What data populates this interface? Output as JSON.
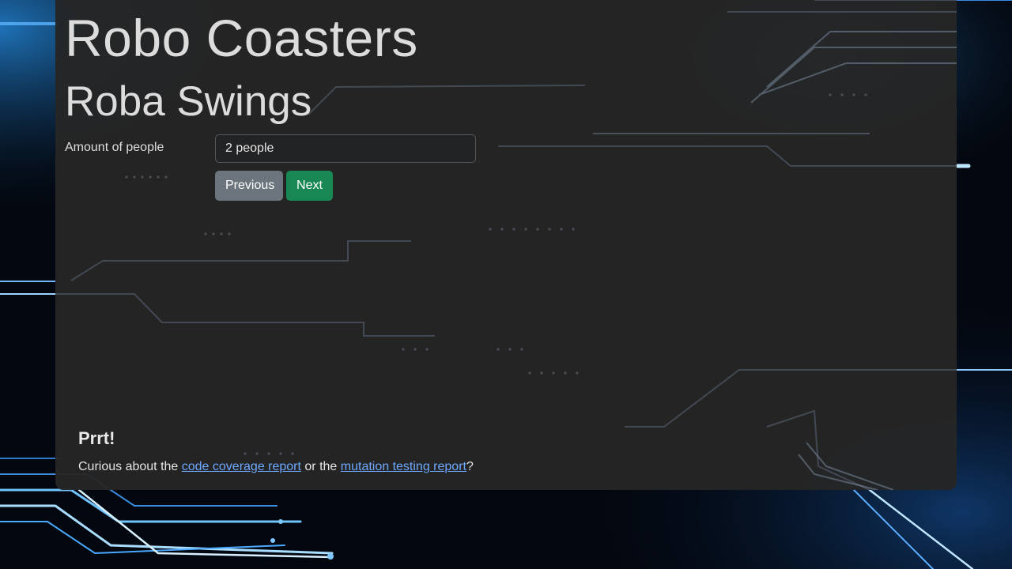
{
  "header": {
    "brand": "Robo Coasters",
    "ride_title": "Roba Swings"
  },
  "form": {
    "people_label": "Amount of people",
    "people_value": "2 people",
    "previous_label": "Previous",
    "next_label": "Next"
  },
  "footer": {
    "title": "Prrt!",
    "text_before": "Curious about the ",
    "coverage_link": "code coverage report",
    "text_middle": " or the ",
    "mutation_link": "mutation testing report",
    "text_after": "?"
  },
  "colors": {
    "panel": "#252525",
    "accent_next": "#198754",
    "secondary_previous": "#6c757d",
    "link": "#6ea8fe",
    "circuit_glow": "#4db8ff"
  },
  "icons": {
    "background": "circuit-board-background"
  }
}
